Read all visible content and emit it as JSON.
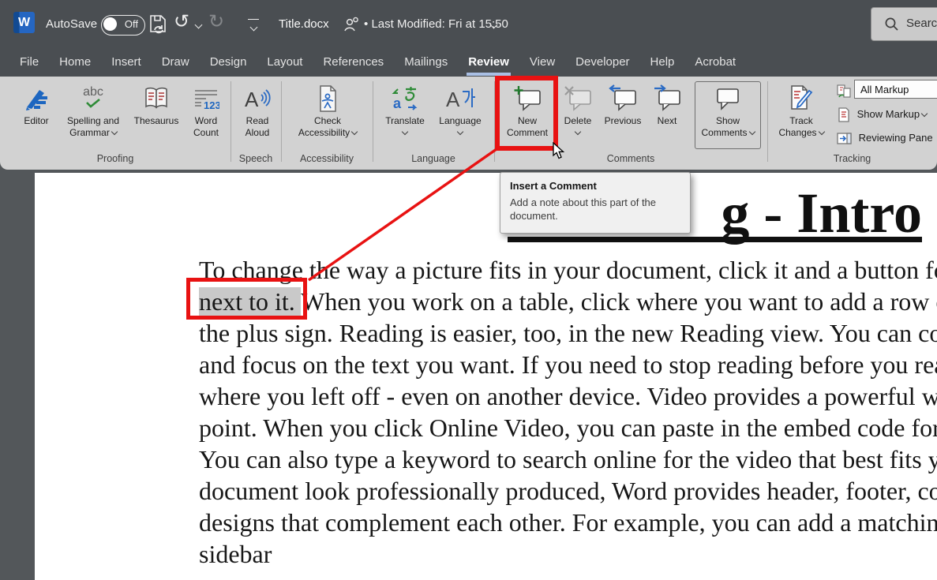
{
  "title_bar": {
    "app_initial": "W",
    "autosave_label": "AutoSave",
    "autosave_state": "Off",
    "doc_title": "Title.docx",
    "bullet": "•",
    "last_modified": "Last Modified: Fri at 15:50",
    "search_label": "Search",
    "undo_glyph": "↺",
    "redo_glyph": "↻"
  },
  "menu": {
    "tabs": [
      {
        "label": "File"
      },
      {
        "label": "Home"
      },
      {
        "label": "Insert"
      },
      {
        "label": "Draw"
      },
      {
        "label": "Design"
      },
      {
        "label": "Layout"
      },
      {
        "label": "References"
      },
      {
        "label": "Mailings"
      },
      {
        "label": "Review",
        "active": true
      },
      {
        "label": "View"
      },
      {
        "label": "Developer"
      },
      {
        "label": "Help"
      },
      {
        "label": "Acrobat"
      }
    ]
  },
  "ribbon": {
    "groups": {
      "proofing": "Proofing",
      "speech": "Speech",
      "accessibility": "Accessibility",
      "language": "Language",
      "comments": "Comments",
      "tracking": "Tracking"
    },
    "buttons": {
      "editor": "Editor",
      "spelling_line1": "Spelling and",
      "spelling_line2": "Grammar",
      "thesaurus": "Thesaurus",
      "word_count_line1": "Word",
      "word_count_line2": "Count",
      "read_aloud_line1": "Read",
      "read_aloud_line2": "Aloud",
      "check_acc_line1": "Check",
      "check_acc_line2": "Accessibility",
      "translate": "Translate",
      "language": "Language",
      "new_comment_line1": "New",
      "new_comment_line2": "Comment",
      "delete": "Delete",
      "previous": "Previous",
      "next": "Next",
      "show_comments_line1": "Show",
      "show_comments_line2": "Comments",
      "track_changes_line1": "Track",
      "track_changes_line2": "Changes",
      "all_markup": "All Markup",
      "show_markup": "Show Markup",
      "reviewing_pane": "Reviewing Pane"
    },
    "icon_glyphs": {
      "spelling_abc": "abc",
      "word_count_123": "123",
      "read_aloud_A": "A",
      "language_A": "A",
      "translate_a": "a"
    }
  },
  "tooltip": {
    "title": "Insert a Comment",
    "body": "Add a note about this part of the document."
  },
  "document": {
    "title_visible": "g - Intro",
    "body": {
      "line1": "To change the way a picture fits in your document, click it and a button for layout options appears",
      "line2_highlight": "next to it. ",
      "line2_rest": "When you work on a table, click where you want to add a row or a column, and then click",
      "line3": "the plus sign. Reading is easier, too, in the new Reading view. You can collapse parts of the document",
      "line4": "and focus on the text you want. If you need to stop reading before you reach the end, Word remembers",
      "line5": "where you left off - even on another device. Video provides a powerful way to help you prove your",
      "line6": "point. When you click Online Video, you can paste in the embed code for the video you want to add.",
      "line7": "You can also type a keyword to search online for the video that best fits your document. To make your",
      "line8": "document look professionally produced, Word provides header, footer, cover page, and text box",
      "line9": "designs that complement each other. For example, you can add a matching cover page, header, and",
      "line10": "sidebar"
    }
  },
  "colors": {
    "annotation_red": "#e81212",
    "chrome_dark": "#4a4e52",
    "canvas_dark": "#53575a",
    "ribbon_gray": "#d2d2d2",
    "selection_gray": "#c9c9c9",
    "review_tab_underline": "#a9bfe4",
    "editor_blue": "#1d66c0",
    "check_green": "#2e8b37"
  }
}
